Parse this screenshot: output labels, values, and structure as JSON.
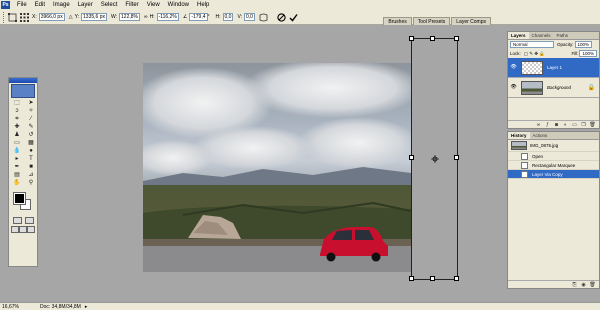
{
  "menu": [
    "File",
    "Edit",
    "Image",
    "Layer",
    "Select",
    "Filter",
    "View",
    "Window",
    "Help"
  ],
  "options": {
    "x_label": "X:",
    "x_value": "3966,0 px",
    "y_label": "Y:",
    "y_value": "1335,6 px",
    "w_label": "W:",
    "w_value": "122,8%",
    "h_label": "H:",
    "h_value": "-116,2%",
    "angle_value": "-179,4",
    "hskew_label": "H:",
    "hskew_value": "0,0",
    "vskew_label": "V:",
    "vskew_value": "0,0"
  },
  "wells": [
    "Brushes",
    "Tool Presets",
    "Layer Comps"
  ],
  "layers_panel": {
    "tabs": [
      "Layers",
      "Channels",
      "Paths"
    ],
    "blend_mode": "Normal",
    "opacity_label": "Opacity:",
    "opacity_value": "100%",
    "lock_label": "Lock:",
    "fill_label": "Fill:",
    "fill_value": "100%",
    "layers": [
      {
        "name": "Layer 1",
        "active": true
      },
      {
        "name": "Background",
        "active": false
      }
    ]
  },
  "history_panel": {
    "tabs": [
      "History",
      "Actions"
    ],
    "snapshot": "IMG_0875.jpg",
    "states": [
      "Open",
      "Rectangular Marquee",
      "Layer Via Copy"
    ],
    "active_index": 2
  },
  "status": {
    "zoom": "16,67%",
    "doc": "Doc: 34,8M/34,8M"
  },
  "icons": {
    "commit": "check-icon",
    "cancel": "cancel-icon",
    "toggle": "warp-icon"
  },
  "colors": {
    "foreground": "#000000",
    "background": "#ffffff",
    "selection": "#316ac5",
    "car": "#c8102e"
  }
}
